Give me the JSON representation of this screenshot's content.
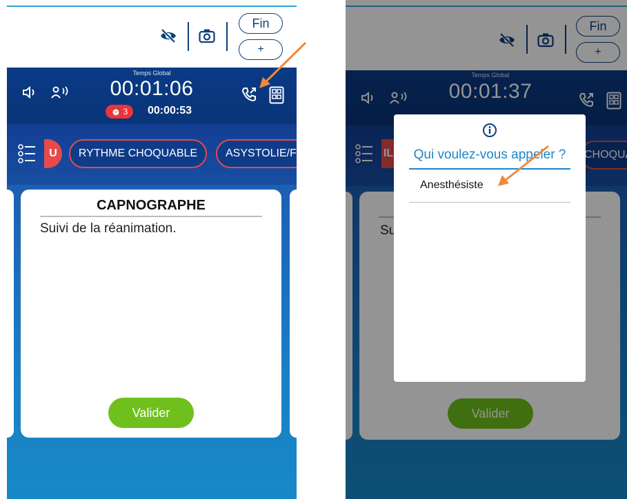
{
  "left_screen": {
    "topbar": {
      "end_label": "Fin",
      "plus_label": "+"
    },
    "header": {
      "global_label": "Temps Global",
      "global_time": "00:01:06",
      "alarm_count": "3",
      "sub_time": "00:00:53"
    },
    "chips": {
      "partial_left": "U",
      "chip_1": "RYTHME CHOQUABLE",
      "chip_2": "ASYSTOLIE/F"
    },
    "card": {
      "title": "CAPNOGRAPHE",
      "text": "Suivi de la réanimation.",
      "button": "Valider"
    }
  },
  "right_screen": {
    "topbar": {
      "end_label": "Fin",
      "plus_label": "+"
    },
    "header": {
      "global_label": "Temps Global",
      "global_time": "00:01:37"
    },
    "chips": {
      "partial_left": "IL",
      "partial_right": "CHOQUA"
    },
    "card": {
      "text_partial": "Su",
      "button": "Valider"
    },
    "dialog": {
      "title": "Qui voulez-vous appeler ?",
      "item": "Anesthésiste"
    }
  },
  "colors": {
    "navy": "#0b3f7a",
    "header_blue": "#0b3a86",
    "chip_border": "#e64a4a",
    "accent_green": "#6fc01c",
    "dialog_blue": "#1b86c8",
    "annotation_arrow": "#ef8a3c"
  },
  "icons": [
    "eye-off-icon",
    "camera-icon",
    "speaker-icon",
    "person-voice-icon",
    "phone-call-icon",
    "calculator-icon",
    "alarm-clock-icon",
    "checklist-icon",
    "info-icon"
  ]
}
